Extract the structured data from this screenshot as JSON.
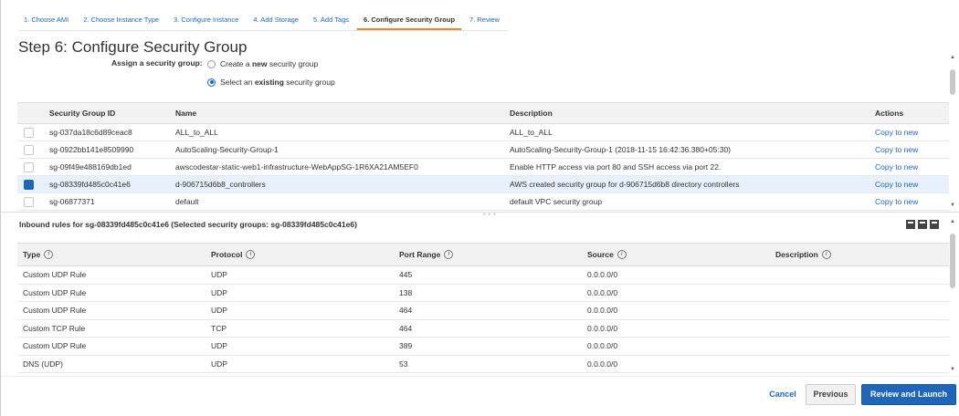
{
  "wizard": {
    "tabs": [
      {
        "label": "1. Choose AMI"
      },
      {
        "label": "2. Choose Instance Type"
      },
      {
        "label": "3. Configure Instance"
      },
      {
        "label": "4. Add Storage"
      },
      {
        "label": "5. Add Tags"
      },
      {
        "label": "6. Configure Security Group"
      },
      {
        "label": "7. Review"
      }
    ],
    "active_tab": 5
  },
  "page": {
    "title": "Step 6: Configure Security Group",
    "assign_label": "Assign a security group:",
    "radio_create": {
      "pre": "Create a ",
      "bold": "new",
      "post": " security group"
    },
    "radio_select": {
      "pre": "Select an ",
      "bold": "existing",
      "post": " security group"
    }
  },
  "sg_table": {
    "headers": {
      "id": "Security Group ID",
      "name": "Name",
      "description": "Description",
      "actions": "Actions"
    },
    "rows": [
      {
        "id": "sg-037da18c6d89ceac8",
        "name": "ALL_to_ALL",
        "description": "ALL_to_ALL",
        "action": "Copy to new",
        "selected": false
      },
      {
        "id": "sg-0922bb141e8509990",
        "name": "AutoScaling-Security-Group-1",
        "description": "AutoScaling-Security-Group-1 (2018-11-15 16:42:36.380+05:30)",
        "action": "Copy to new",
        "selected": false
      },
      {
        "id": "sg-09f49e488169db1ed",
        "name": "awscodestar-static-web1-infrastructure-WebAppSG-1R6XA21AM5EF0",
        "description": "Enable HTTP access via port 80 and SSH access via port 22.",
        "action": "Copy to new",
        "selected": false
      },
      {
        "id": "sg-08339fd485c0c41e6",
        "name": "d-906715d6b8_controllers",
        "description": "AWS created security group for d-906715d6b8 directory controllers",
        "action": "Copy to new",
        "selected": true
      },
      {
        "id": "sg-06877371",
        "name": "default",
        "description": "default VPC security group",
        "action": "Copy to new",
        "selected": false
      }
    ]
  },
  "inbound": {
    "title": "Inbound rules for sg-08339fd485c0c41e6 (Selected security groups: sg-08339fd485c0c41e6)",
    "headers": {
      "type": "Type",
      "protocol": "Protocol",
      "port_range": "Port Range",
      "source": "Source",
      "description": "Description"
    },
    "rows": [
      {
        "type": "Custom UDP Rule",
        "protocol": "UDP",
        "port": "445",
        "source": "0.0.0.0/0",
        "description": ""
      },
      {
        "type": "Custom UDP Rule",
        "protocol": "UDP",
        "port": "138",
        "source": "0.0.0.0/0",
        "description": ""
      },
      {
        "type": "Custom UDP Rule",
        "protocol": "UDP",
        "port": "464",
        "source": "0.0.0.0/0",
        "description": ""
      },
      {
        "type": "Custom TCP Rule",
        "protocol": "TCP",
        "port": "464",
        "source": "0.0.0.0/0",
        "description": ""
      },
      {
        "type": "Custom UDP Rule",
        "protocol": "UDP",
        "port": "389",
        "source": "0.0.0.0/0",
        "description": ""
      },
      {
        "type": "DNS (UDP)",
        "protocol": "UDP",
        "port": "53",
        "source": "0.0.0.0/0",
        "description": ""
      }
    ]
  },
  "footer": {
    "cancel": "Cancel",
    "previous": "Previous",
    "review_launch": "Review and Launch"
  },
  "colors": {
    "accent": "#1f66b8",
    "active_tab_underline": "#e7832a",
    "selected_row": "#e8f1fb"
  }
}
